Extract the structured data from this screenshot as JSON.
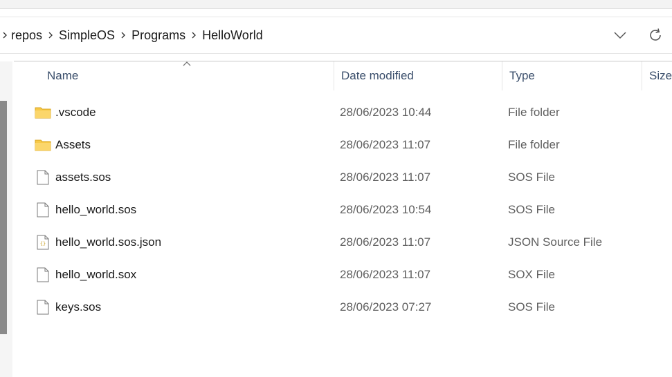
{
  "breadcrumb": {
    "items": [
      {
        "label": "repos"
      },
      {
        "label": "SimpleOS"
      },
      {
        "label": "Programs"
      },
      {
        "label": "HelloWorld"
      }
    ]
  },
  "columns": {
    "name": "Name",
    "date_modified": "Date modified",
    "type": "Type",
    "size": "Size"
  },
  "sort": {
    "column": "name",
    "direction": "ascending"
  },
  "files": [
    {
      "name": ".vscode",
      "date": "28/06/2023 10:44",
      "type": "File folder",
      "icon": "folder-icon"
    },
    {
      "name": "Assets",
      "date": "28/06/2023 11:07",
      "type": "File folder",
      "icon": "folder-icon"
    },
    {
      "name": "assets.sos",
      "date": "28/06/2023 11:07",
      "type": "SOS File",
      "icon": "file-icon"
    },
    {
      "name": "hello_world.sos",
      "date": "28/06/2023 10:54",
      "type": "SOS File",
      "icon": "file-icon"
    },
    {
      "name": "hello_world.sos.json",
      "date": "28/06/2023 11:07",
      "type": "JSON Source File",
      "icon": "json-file-icon"
    },
    {
      "name": "hello_world.sox",
      "date": "28/06/2023 11:07",
      "type": "SOX File",
      "icon": "file-icon"
    },
    {
      "name": "keys.sos",
      "date": "28/06/2023 07:27",
      "type": "SOS File",
      "icon": "file-icon"
    }
  ],
  "colors": {
    "folder": "#f7c948",
    "header_text": "#3a4e6b",
    "json_icon": "#c9a227"
  }
}
